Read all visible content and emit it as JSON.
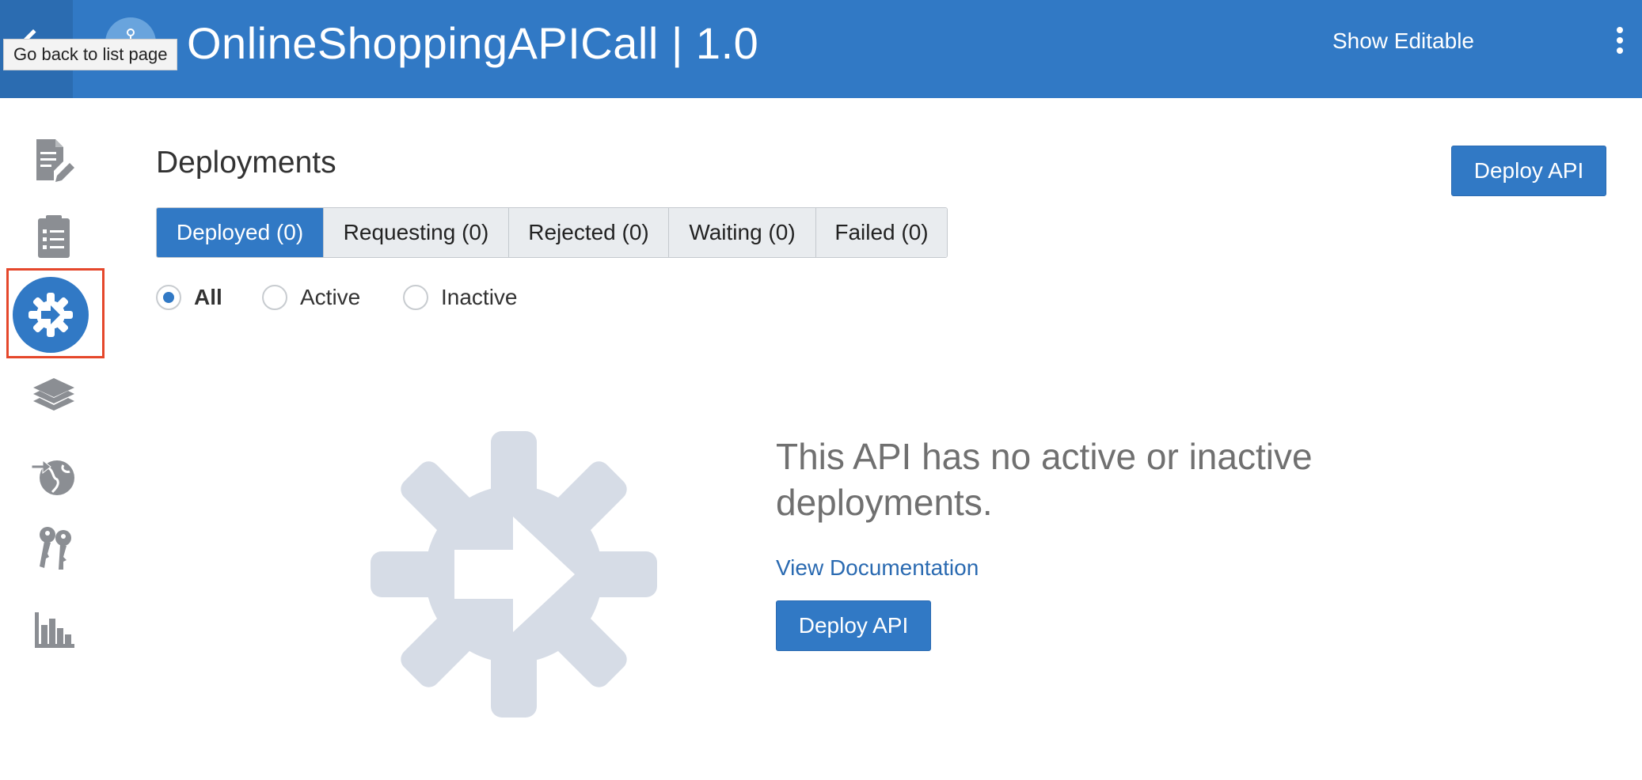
{
  "header": {
    "title": "OnlineShoppingAPICall | 1.0",
    "back_tooltip": "Go back to list page",
    "show_editable": "Show Editable"
  },
  "sidebar": {
    "items": [
      {
        "icon": "document-edit-icon"
      },
      {
        "icon": "checklist-icon"
      },
      {
        "icon": "deployment-gear-icon",
        "active": true
      },
      {
        "icon": "layers-icon"
      },
      {
        "icon": "globe-publish-icon"
      },
      {
        "icon": "keys-icon"
      },
      {
        "icon": "analytics-chart-icon"
      }
    ]
  },
  "main": {
    "title": "Deployments",
    "deploy_button": "Deploy API",
    "tabs": [
      {
        "label": "Deployed (0)",
        "active": true
      },
      {
        "label": "Requesting (0)"
      },
      {
        "label": "Rejected (0)"
      },
      {
        "label": "Waiting (0)"
      },
      {
        "label": "Failed (0)"
      }
    ],
    "filters": [
      {
        "label": "All",
        "checked": true
      },
      {
        "label": "Active"
      },
      {
        "label": "Inactive"
      }
    ],
    "empty": {
      "message": "This API has no active or inactive deployments.",
      "link": "View Documentation",
      "button": "Deploy API"
    }
  },
  "colors": {
    "header": "#3179c5",
    "accent": "#3179c5",
    "highlight_border": "#e5472b",
    "illustration": "#d6dce6"
  }
}
